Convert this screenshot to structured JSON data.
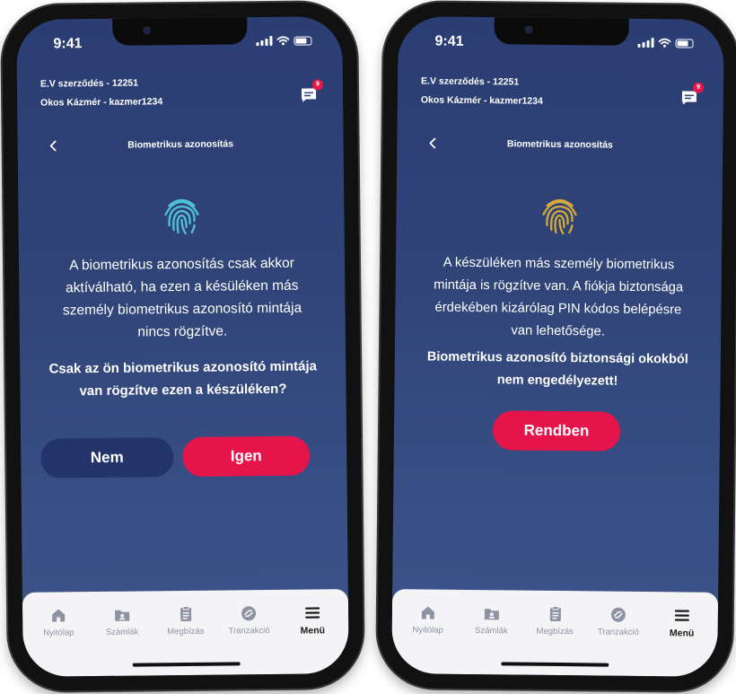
{
  "status": {
    "time": "9:41"
  },
  "header": {
    "contract": "E.V szerződés - 12251",
    "user": "Okos Kázmér - kazmer1234",
    "badge_count": "9"
  },
  "screen_title": "Biometrikus azonosítás",
  "colors": {
    "primary": "#e5154c",
    "secondary": "#233568",
    "fingerprint_ok": "#4fc3d4",
    "fingerprint_warn": "#d4a93a"
  },
  "left": {
    "icon": "fingerprint-icon",
    "message_lines": [
      "A biometrikus azonosítás csak akkor",
      "aktíválható, ha ezen a késüléken más",
      "személy biometrikus azonosító mintája",
      "nincs rögzítve."
    ],
    "question_lines": [
      "Csak az ön biometrikus azonosító mintája",
      "van rögzítve ezen a készüléken?"
    ],
    "no_label": "Nem",
    "yes_label": "Igen"
  },
  "right": {
    "icon": "fingerprint-icon",
    "message_lines": [
      "A készüléken más személy biometrikus",
      "mintája is rögzítve van. A fiókja biztonsága",
      "érdekében kizárólag PIN kódos belépésre",
      "van lehetősége."
    ],
    "warning_lines": [
      "Biometrikus azonosító biztonsági okokból",
      "nem engedélyezett!"
    ],
    "ok_label": "Rendben"
  },
  "tabbar": {
    "items": [
      {
        "label": "Nyitólap",
        "icon": "home-icon"
      },
      {
        "label": "Számlák",
        "icon": "accounts-icon"
      },
      {
        "label": "Megbízás",
        "icon": "clipboard-icon"
      },
      {
        "label": "Tranzakció",
        "icon": "transfer-icon"
      },
      {
        "label": "Menü",
        "icon": "menu-icon"
      }
    ]
  }
}
